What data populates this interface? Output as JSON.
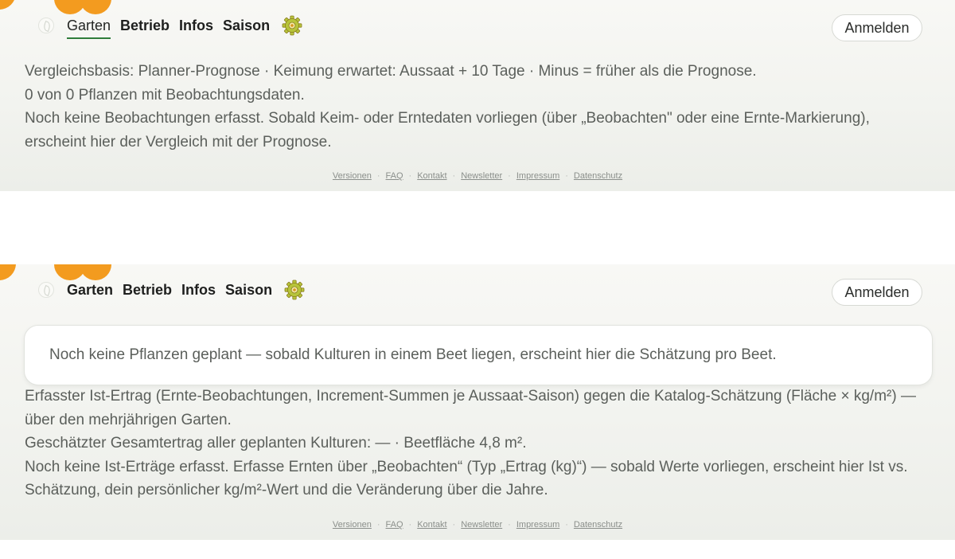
{
  "nav": {
    "items": [
      "Garten",
      "Betrieb",
      "Infos",
      "Saison"
    ],
    "settings_icon": "gear-icon",
    "login_label": "Anmelden"
  },
  "top_view": {
    "active_tab": "Garten",
    "lines": [
      "Vergleichsbasis: Planner-Prognose · Keimung erwartet: Aussaat + 10 Tage · Minus = früher als die Prognose.",
      "0 von 0 Pflanzen mit Beobachtungsdaten.",
      "Noch keine Beobachtungen erfasst. Sobald Keim- oder Erntedaten vorliegen (über „Beobachten\" oder eine Ernte-Markierung), erscheint hier der Vergleich mit der Prognose."
    ]
  },
  "bottom_view": {
    "card_text": "Noch keine Pflanzen geplant — sobald Kulturen in einem Beet liegen, erscheint hier die Schätzung pro Beet.",
    "lines": [
      "Erfasster Ist-Ertrag (Ernte-Beobachtungen, Increment-Summen je Aussaat-Saison) gegen die Katalog-Schätzung (Fläche × kg/m²) — über den mehrjährigen Garten.",
      "Geschätzter Gesamtertrag aller geplanten Kulturen: — · Beetfläche 4,8 m².",
      "Noch keine Ist-Erträge erfasst. Erfasse Ernten über „Beobachten“ (Typ „Ertrag (kg)“) — sobald Werte vorliegen, erscheint hier Ist vs. Schätzung, dein persönlicher kg/m²-Wert und die Veränderung über die Jahre."
    ]
  },
  "footer": {
    "links": [
      "Versionen",
      "FAQ",
      "Kontakt",
      "Newsletter",
      "Impressum",
      "Datenschutz"
    ]
  },
  "colors": {
    "accent_orange": "#f39b1f",
    "active_underline": "#2f7d3b"
  }
}
